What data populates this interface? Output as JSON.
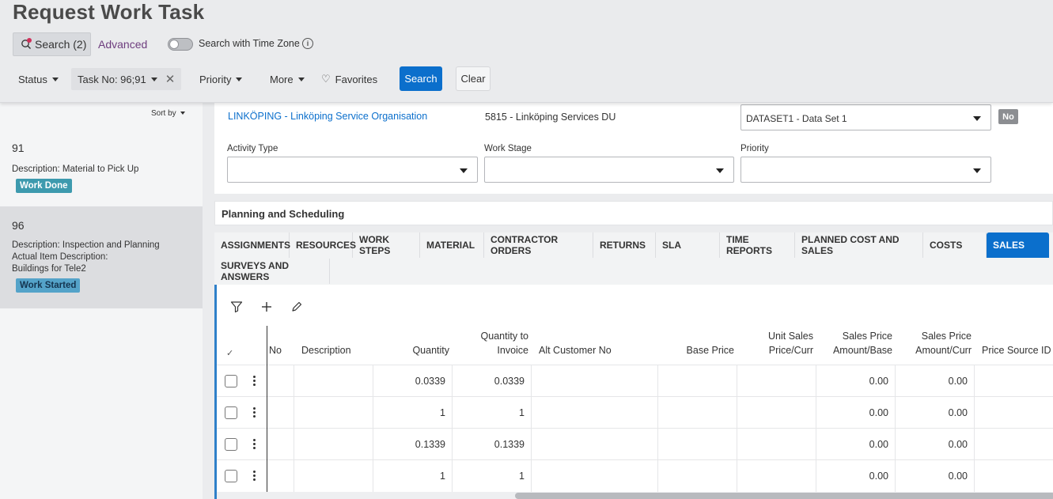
{
  "header": {
    "title": "Request Work Task",
    "search_button": "Search (2)",
    "advanced": "Advanced",
    "time_zone_label": "Search with Time Zone",
    "info_glyph": "i",
    "filters": {
      "status": "Status",
      "task_no": "Task No: 96;91",
      "priority": "Priority",
      "more": "More",
      "favorites": "Favorites"
    },
    "search": "Search",
    "clear": "Clear"
  },
  "list": {
    "sort_by": "Sort by",
    "items": [
      {
        "number": "91",
        "description": "Description:  Material to Pick Up",
        "status": "Work Done"
      },
      {
        "number": "96",
        "description": "Description:  Inspection and Planning",
        "actual_desc_label": "Actual Item Description:",
        "actual_desc_value": "Buildings for Tele2",
        "status": "Work Started"
      }
    ]
  },
  "form": {
    "org_link": "LINKÖPING - Linköping Service Organisation",
    "site": "5815 - Linköping Services DU",
    "dataset": "DATASET1 - Data Set 1",
    "no_chip": "No",
    "activity_type_label": "Activity Type",
    "work_stage_label": "Work Stage",
    "priority_label": "Priority"
  },
  "planning": {
    "title": "Planning and Scheduling"
  },
  "tabs": [
    "ASSIGNMENTS",
    "RESOURCES",
    "WORK STEPS",
    "MATERIAL",
    "CONTRACTOR ORDERS",
    "RETURNS",
    "SLA",
    "TIME REPORTS",
    "PLANNED COST AND SALES",
    "COSTS",
    "SALES",
    "SURVEYS AND ANSWERS"
  ],
  "active_tab": "SALES",
  "grid": {
    "headers": {
      "no": "No",
      "description": "Description",
      "quantity": "Quantity",
      "qty_invoice_1": "Quantity to",
      "qty_invoice_2": "Invoice",
      "alt_customer": "Alt Customer No",
      "base_price": "Base Price",
      "unit_sales_1": "Unit Sales",
      "unit_sales_2": "Price/Curr",
      "sp_base_1": "Sales Price",
      "sp_base_2": "Amount/Base",
      "sp_curr_1": "Sales Price",
      "sp_curr_2": "Amount/Curr",
      "price_source": "Price Source ID"
    },
    "rows": [
      {
        "quantity": "0.0339",
        "qty_invoice": "0.0339",
        "sp_base": "0.00",
        "sp_curr": "0.00"
      },
      {
        "quantity": "1",
        "qty_invoice": "1",
        "sp_base": "0.00",
        "sp_curr": "0.00"
      },
      {
        "quantity": "0.1339",
        "qty_invoice": "0.1339",
        "sp_base": "0.00",
        "sp_curr": "0.00"
      },
      {
        "quantity": "1",
        "qty_invoice": "1",
        "sp_base": "0.00",
        "sp_curr": "0.00"
      }
    ]
  },
  "colors": {
    "accent": "#0b6fcc",
    "badge_done": "#3d9aae",
    "badge_started": "#54a3c9",
    "link": "#6e3d7e"
  }
}
